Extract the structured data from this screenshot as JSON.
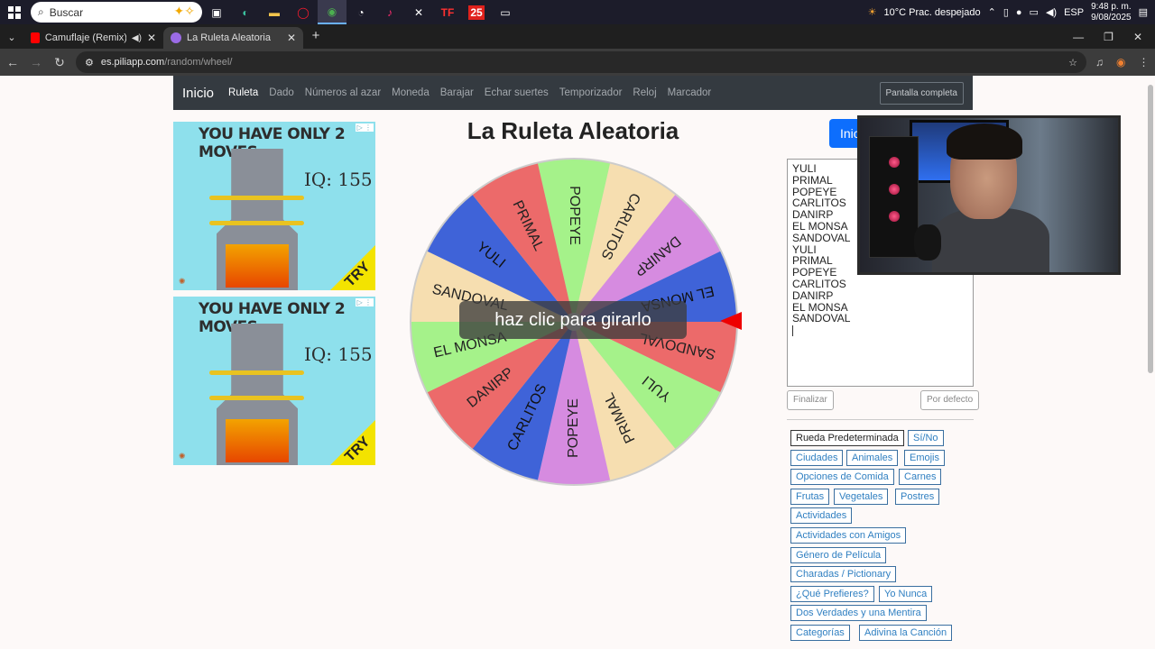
{
  "taskbar": {
    "search_placeholder": "Buscar",
    "apps": [
      "task-view",
      "edge",
      "explorer",
      "opera",
      "chrome",
      "github-desktop",
      "tiktok",
      "capcut",
      "tf",
      "25",
      "files"
    ],
    "app_label_tf": "TF",
    "app_label_25": "25",
    "weather": "10°C  Prac. despejado",
    "language": "ESP",
    "time": "9:48 p. m.",
    "date": "9/08/2025"
  },
  "tabs": [
    {
      "title": "Camuflaje (Remix) - YouTub",
      "favicon_color": "#ff0000",
      "audio": true
    },
    {
      "title": "La Ruleta Aleatoria",
      "favicon_color": "#9b6be6",
      "active": true
    }
  ],
  "address": {
    "domain": "es.piliapp.com",
    "path": "/random/wheel/"
  },
  "navbar": {
    "brand": "Inicio",
    "links": [
      "Ruleta",
      "Dado",
      "Números al azar",
      "Moneda",
      "Barajar",
      "Echar suertes",
      "Temporizador",
      "Reloj",
      "Marcador"
    ],
    "active_index": 0,
    "fullscreen": "Pantalla completa"
  },
  "ads": [
    {
      "title": "YOU HAVE ONLY 2 MOVES",
      "iq": "IQ: 155",
      "cta": "TRY",
      "info": "▷ ⋮"
    },
    {
      "title": "YOU HAVE ONLY 2 MOVES",
      "iq": "IQ: 155",
      "cta": "TRY",
      "info": "▷ ⋮"
    }
  ],
  "wheel": {
    "title": "La Ruleta Aleatoria",
    "overlay_text": "haz clic para girarlo",
    "segments": [
      "POPEYE",
      "CARLITOS",
      "DANIRP",
      "EL MONSA",
      "SANDOVAL",
      "YULI",
      "PRIMAL",
      "POPEYE",
      "CARLITOS",
      "DANIRP",
      "EL MONSA",
      "SANDOVAL",
      "YULI",
      "PRIMAL"
    ],
    "colors": {
      "POPEYE": "#a5f28a",
      "CARLITOS": "#f6deb0",
      "DANIRP": "#d68be0",
      "EL MONSA": "#3f63d8",
      "SANDOVAL": "#ec6a6a",
      "YULI": "#a5f28a",
      "PRIMAL": "#f6deb0"
    },
    "colors_second_half": {
      "POPEYE": "#d68be0",
      "CARLITOS": "#3f63d8",
      "DANIRP": "#ec6a6a",
      "EL MONSA": "#a5f28a",
      "SANDOVAL": "#f6deb0",
      "YULI": "#3f63d8",
      "PRIMAL": "#ec6a6a"
    }
  },
  "controls": {
    "start_label": "Inic",
    "entries": [
      "YULI",
      "PRIMAL",
      "POPEYE",
      "CARLITOS",
      "DANIRP",
      "EL MONSA",
      "SANDOVAL",
      "YULI",
      "PRIMAL",
      "POPEYE",
      "CARLITOS",
      "DANIRP",
      "EL MONSA",
      "SANDOVAL"
    ],
    "finish_label": "Finalizar",
    "default_label": "Por defecto"
  },
  "presets": [
    "Rueda Predeterminada",
    "Sí/No",
    "Ciudades",
    "Animales",
    "Emojis",
    "Opciones de Comida",
    "Carnes",
    "Frutas",
    "Vegetales",
    "Postres",
    "Actividades",
    "Actividades con Amigos",
    "Género de Película",
    "Charadas / Pictionary",
    "¿Qué Prefieres?",
    "Yo Nunca",
    "Dos Verdades y una Mentira",
    "Categorías",
    "Adivina la Canción"
  ]
}
